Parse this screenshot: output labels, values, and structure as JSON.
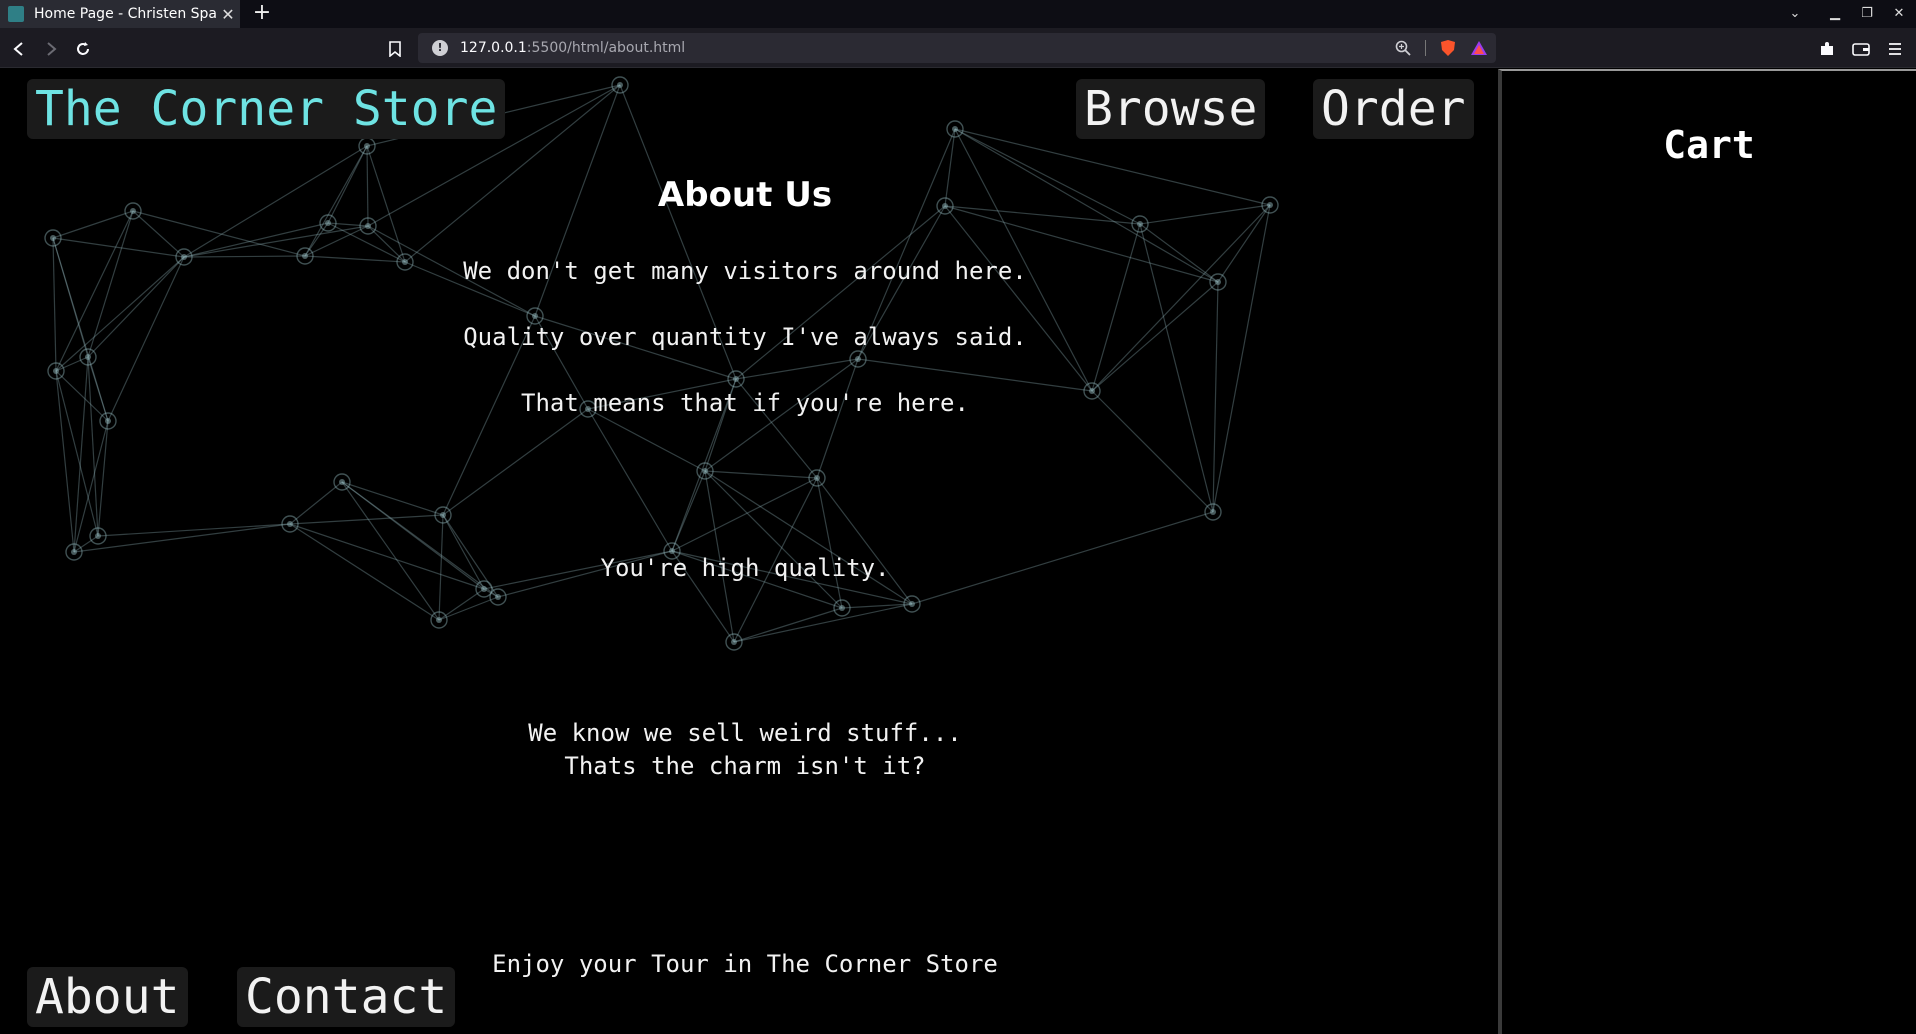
{
  "browser": {
    "tab_title": "Home Page - Christen Spadavecchia",
    "url_host": "127.0.0.1",
    "url_rest": ":5500/html/about.html"
  },
  "site": {
    "brand": "The Corner Store",
    "nav": {
      "browse": "Browse",
      "order": "Order",
      "about": "About",
      "contact": "Contact"
    }
  },
  "about": {
    "heading": "About Us",
    "lines": [
      "We don't get many visitors around here.",
      "Quality over quantity I've always said.",
      "That means that if you're here.",
      "You're high quality.",
      "We know we sell weird stuff...",
      "Thats the charm isn't it?",
      "Enjoy your Tour in The Corner Store"
    ]
  },
  "cart": {
    "title": "Cart"
  },
  "colors": {
    "brand": "#6ee3e3",
    "network": "#8fb3b8",
    "background": "#000000"
  }
}
